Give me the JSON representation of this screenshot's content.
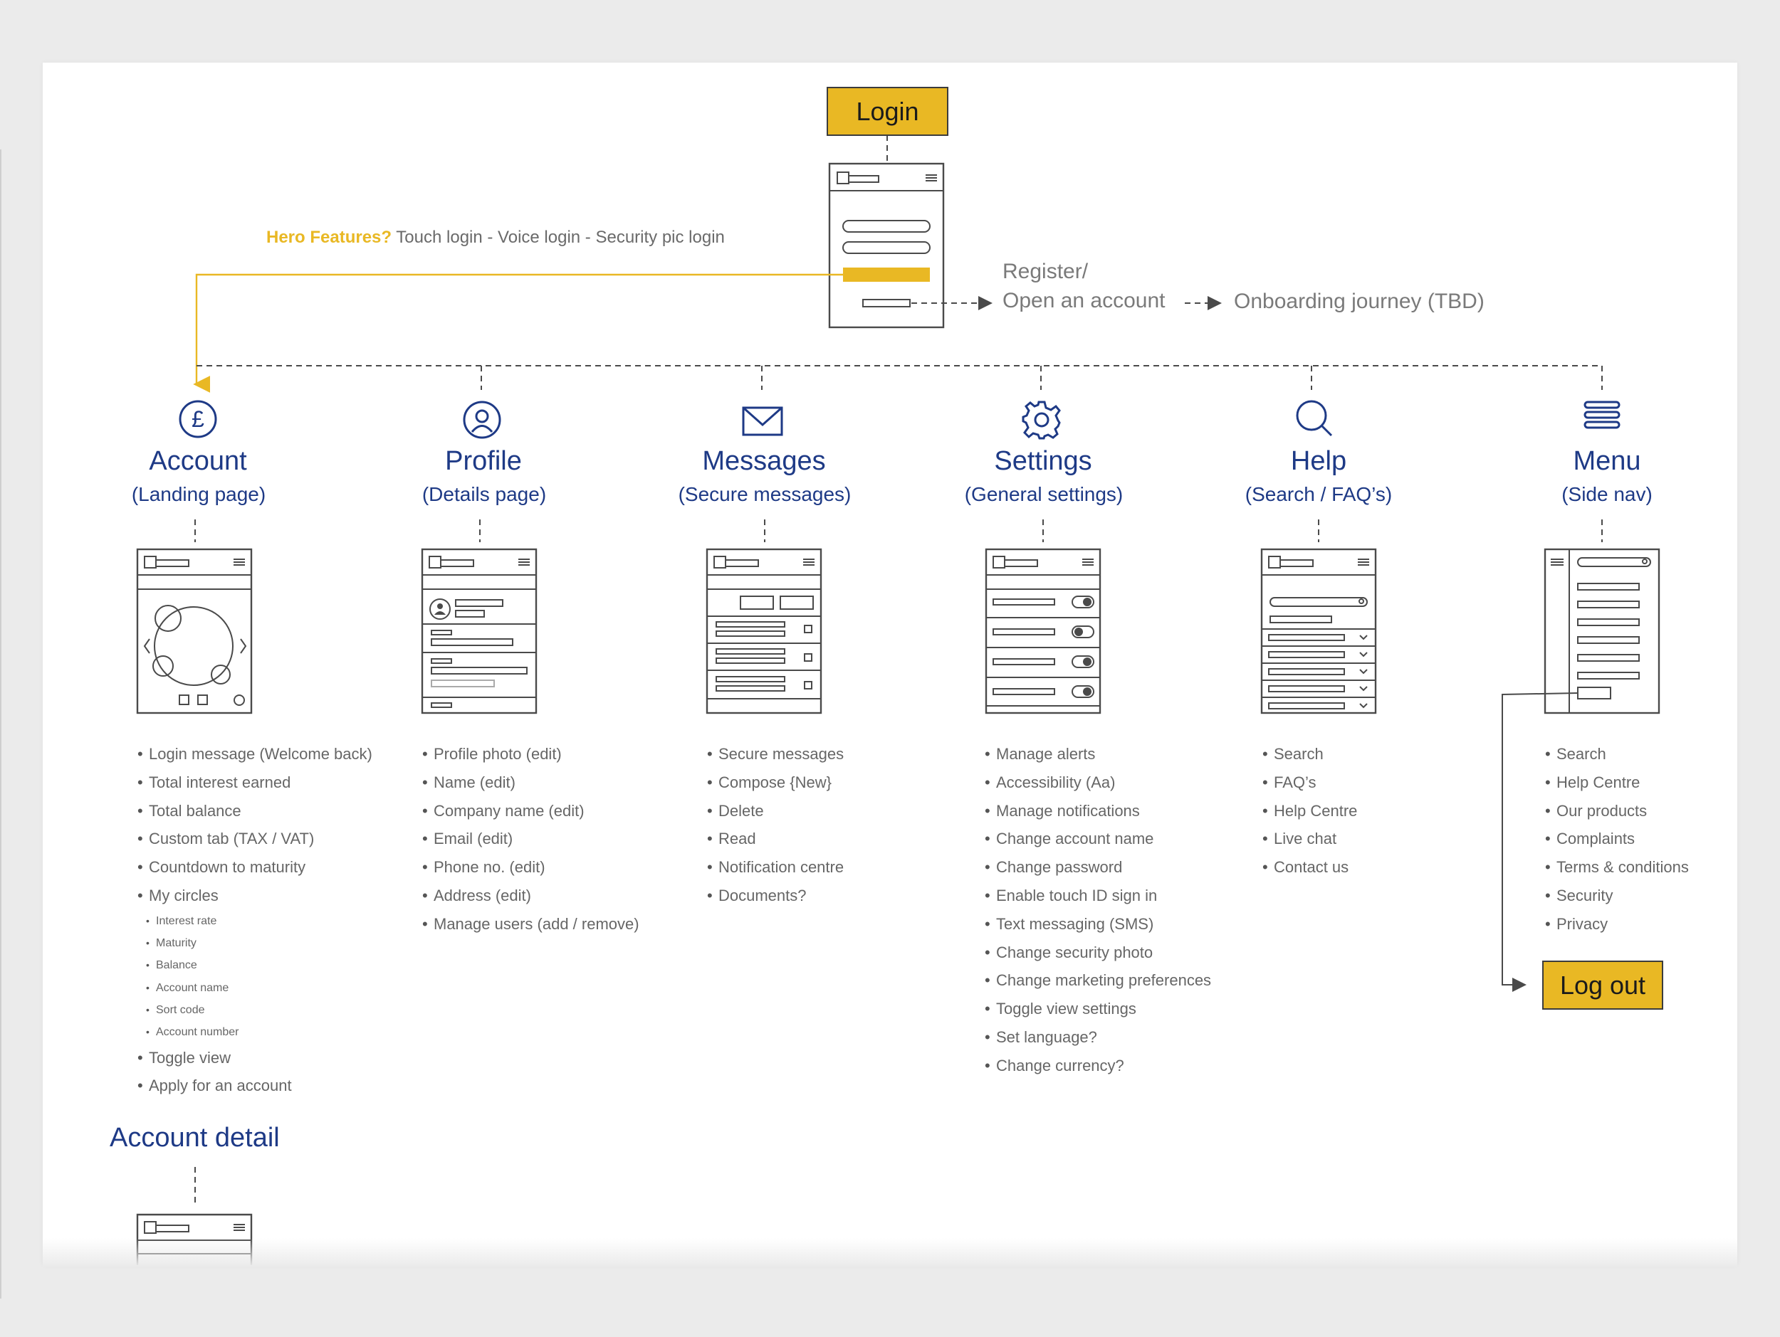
{
  "login": {
    "label": "Login"
  },
  "hero": {
    "label": "Hero Features?",
    "text": "Touch login - Voice login - Security pic login"
  },
  "register": {
    "line1": "Register/",
    "line2": "Open an account",
    "onboarding": "Onboarding journey",
    "tbd": "(TBD)"
  },
  "sections": [
    {
      "title": "Account",
      "subtitle": "(Landing page)",
      "icon": "pound-icon",
      "items": [
        "Login message (Welcome back)",
        "Total interest earned",
        "Total balance",
        "Custom tab (TAX / VAT)",
        "Countdown to maturity",
        "My circles"
      ],
      "subitems": [
        "Interest rate",
        "Maturity",
        "Balance",
        "Account name",
        "Sort code",
        "Account number"
      ],
      "items_after": [
        "Toggle view",
        "Apply for an account"
      ]
    },
    {
      "title": "Profile",
      "subtitle": "(Details page)",
      "icon": "user-icon",
      "items": [
        "Profile photo (edit)",
        "Name (edit)",
        "Company name (edit)",
        "Email (edit)",
        "Phone no. (edit)",
        "Address (edit)",
        "Manage users (add / remove)"
      ]
    },
    {
      "title": "Messages",
      "subtitle": "(Secure messages)",
      "icon": "envelope-icon",
      "items": [
        "Secure messages",
        "Compose {New}",
        "Delete",
        "Read",
        "Notification centre",
        "Documents?"
      ]
    },
    {
      "title": "Settings",
      "subtitle": "(General settings)",
      "icon": "gear-icon",
      "items": [
        "Manage alerts",
        "Accessibility (Aa)",
        "Manage notifications",
        "Change account name",
        "Change password",
        "Enable touch ID sign in",
        "Text messaging (SMS)",
        "Change security photo",
        "Change marketing preferences",
        "Toggle view settings",
        "Set language?",
        "Change currency?"
      ]
    },
    {
      "title": "Help",
      "subtitle": "(Search / FAQ’s)",
      "icon": "search-icon",
      "items": [
        "Search",
        "FAQ’s",
        "Help Centre",
        "Live chat",
        "Contact us"
      ]
    },
    {
      "title": "Menu",
      "subtitle": "(Side nav)",
      "icon": "hamburger-icon",
      "items": [
        "Search",
        "Help Centre",
        "Our products",
        "Complaints",
        "Terms & conditions",
        "Security",
        "Privacy"
      ]
    }
  ],
  "logout": {
    "label": "Log out"
  },
  "account_detail": {
    "title": "Account detail"
  },
  "colors": {
    "navy": "#1e3a86",
    "yellow": "#e9b824",
    "wire": "#4a4a4a",
    "grey_text": "#7a7a7a"
  }
}
